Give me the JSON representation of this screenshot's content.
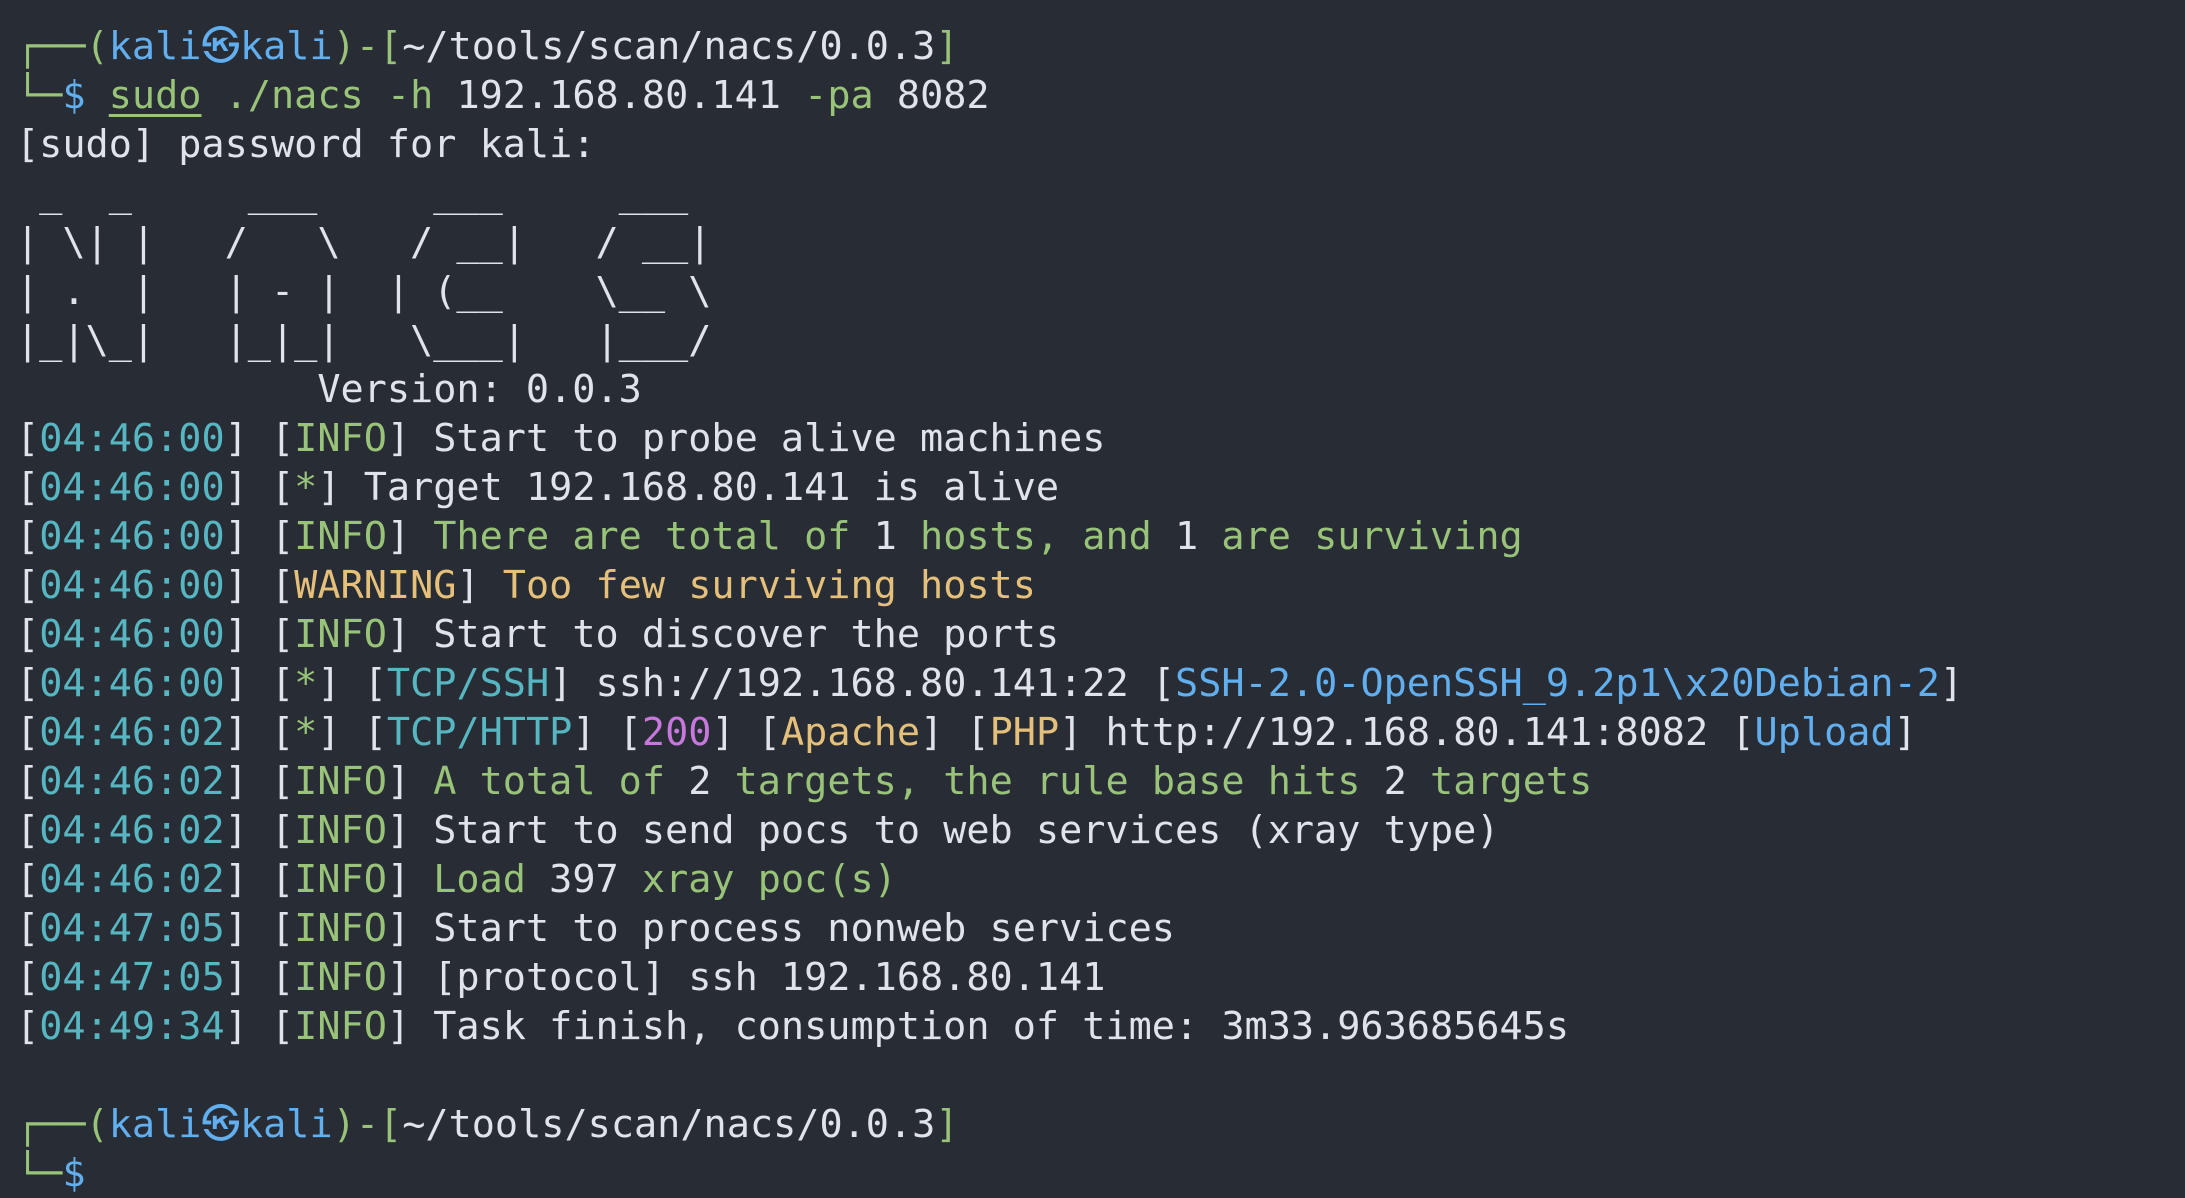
{
  "theme": {
    "background": "#282c34",
    "foreground": "#e0e3ea",
    "green": "#98c379",
    "blue": "#61afef",
    "cyan": "#56b6c2",
    "yellow": "#e5c07b",
    "magenta": "#c678dd"
  },
  "prompt1": {
    "corner": "┌──(",
    "user": "kali",
    "at": "㉿",
    "host": "kali",
    "mid": ")-[",
    "path": "~/tools/scan/nacs/0.0.3",
    "close": "]",
    "corner2": "└─",
    "dollar": "$",
    "cmd_sudo": "sudo",
    "cmd_bin": "./nacs",
    "flag_h": "-h",
    "arg_host": "192.168.80.141",
    "flag_pa": "-pa",
    "arg_port": "8082"
  },
  "sudo_prompt": "[sudo] password for kali:",
  "banner": [
    " _  _     ___     ___     ___ ",
    "| \\| |   /   \\   / __|   / __|",
    "| .  |   | - |  | (__    \\__ \\",
    "|_|\\_|   |_|_|   \\___|   |___/",
    "             Version: 0.0.3"
  ],
  "logs": {
    "l1": {
      "time": "04:46:00",
      "tag": "INFO",
      "msg": "Start to probe alive machines"
    },
    "l2": {
      "time": "04:46:00",
      "tag": "*",
      "msg": "Target 192.168.80.141 is alive"
    },
    "l3": {
      "time": "04:46:00",
      "tag": "INFO",
      "a": "There are total of",
      "n1": "1",
      "b": "hosts, and",
      "n2": "1",
      "c": "are surviving"
    },
    "l4": {
      "time": "04:46:00",
      "tag": "WARNING",
      "msg": "Too few surviving hosts"
    },
    "l5": {
      "time": "04:46:00",
      "tag": "INFO",
      "msg": "Start to discover the ports"
    },
    "l6": {
      "time": "04:46:00",
      "tag": "*",
      "proto": "TCP/SSH",
      "url": "ssh://192.168.80.141:22",
      "banner": "SSH-2.0-OpenSSH_9.2p1\\x20Debian-2"
    },
    "l7": {
      "time": "04:46:02",
      "tag": "*",
      "proto": "TCP/HTTP",
      "code": "200",
      "server": "Apache",
      "lang": "PHP",
      "url": "http://192.168.80.141:8082",
      "title": "Upload"
    },
    "l8": {
      "time": "04:46:02",
      "tag": "INFO",
      "a": "A total of",
      "n1": "2",
      "b": "targets, the rule base hits",
      "n2": "2",
      "c": "targets"
    },
    "l9": {
      "time": "04:46:02",
      "tag": "INFO",
      "msg": "Start to send pocs to web services (xray type)"
    },
    "l10": {
      "time": "04:46:02",
      "tag": "INFO",
      "a": "Load",
      "n1": "397",
      "b": "xray poc(s)"
    },
    "l11": {
      "time": "04:47:05",
      "tag": "INFO",
      "msg": "Start to process nonweb services"
    },
    "l12": {
      "time": "04:47:05",
      "tag": "INFO",
      "msg": "[protocol] ssh 192.168.80.141"
    },
    "l13": {
      "time": "04:49:34",
      "tag": "INFO",
      "msg": "Task finish, consumption of time: 3m33.963685645s"
    }
  },
  "prompt2": {
    "corner": "┌──(",
    "user": "kali",
    "at": "㉿",
    "host": "kali",
    "mid": ")-[",
    "path": "~/tools/scan/nacs/0.0.3",
    "close": "]",
    "corner2": "└─",
    "dollar": "$"
  }
}
